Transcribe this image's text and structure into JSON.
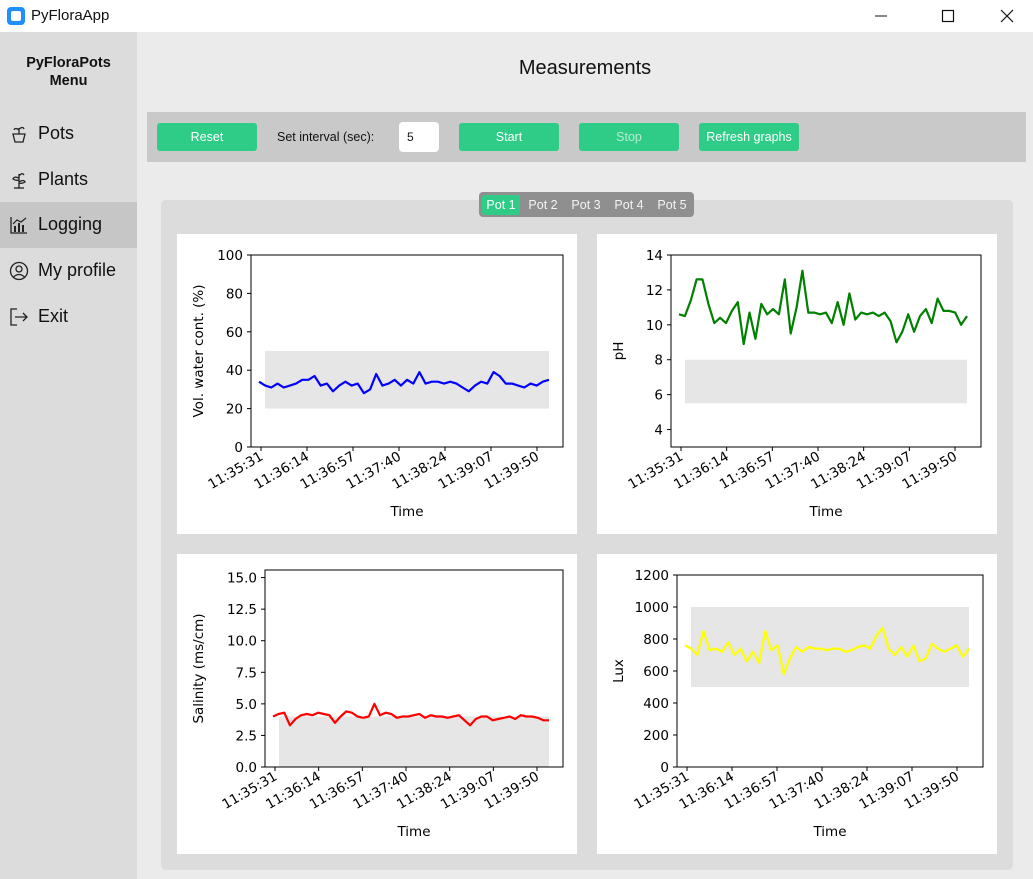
{
  "window": {
    "title": "PyFloraApp"
  },
  "sidebar": {
    "title_line1": "PyFloraPots",
    "title_line2": "Menu",
    "items": [
      {
        "label": "Pots",
        "icon": "pot-icon"
      },
      {
        "label": "Plants",
        "icon": "plant-icon"
      },
      {
        "label": "Logging",
        "icon": "chart-icon"
      },
      {
        "label": "My profile",
        "icon": "user-icon"
      },
      {
        "label": "Exit",
        "icon": "exit-icon"
      }
    ]
  },
  "page": {
    "title": "Measurements"
  },
  "toolbar": {
    "reset": "Reset",
    "interval_label": "Set interval (sec):",
    "interval_value": "5",
    "start": "Start",
    "stop": "Stop",
    "refresh": "Refresh graphs"
  },
  "tabs": [
    "Pot 1",
    "Pot 2",
    "Pot 3",
    "Pot 4",
    "Pot 5"
  ],
  "colors": {
    "accent": "#2ecc87",
    "band": "#e6e6e6"
  },
  "chart_data": [
    {
      "type": "line",
      "xlabel": "Time",
      "ylabel": "Vol. water cont. (%)",
      "ylim": [
        0,
        100
      ],
      "yticks": [
        "0",
        "20",
        "40",
        "60",
        "80",
        "100"
      ],
      "xticks": [
        "11:35:31",
        "11:36:14",
        "11:36:57",
        "11:37:40",
        "11:38:24",
        "11:39:07",
        "11:39:50"
      ],
      "band": [
        20,
        50
      ],
      "color": "#0000ff",
      "values": [
        34,
        32,
        31,
        33,
        31,
        32,
        33,
        35,
        35,
        37,
        32,
        33,
        29,
        32,
        34,
        32,
        33,
        28,
        30,
        38,
        32,
        33,
        35,
        32,
        35,
        33,
        39,
        33,
        34,
        34,
        33,
        34,
        33,
        31,
        29,
        32,
        34,
        33,
        39,
        37,
        33,
        33,
        32,
        31,
        33,
        32,
        34,
        35
      ]
    },
    {
      "type": "line",
      "xlabel": "Time",
      "ylabel": "pH",
      "ylim": [
        3,
        14
      ],
      "yticks": [
        "4",
        "6",
        "8",
        "10",
        "12",
        "14"
      ],
      "xticks": [
        "11:35:31",
        "11:36:14",
        "11:36:57",
        "11:37:40",
        "11:38:24",
        "11:39:07",
        "11:39:50"
      ],
      "band": [
        5.5,
        8
      ],
      "color": "#008000",
      "values": [
        10.6,
        10.5,
        11.4,
        12.6,
        12.6,
        11.2,
        10.1,
        10.4,
        10.1,
        10.8,
        11.3,
        8.9,
        10.7,
        9.2,
        11.2,
        10.6,
        10.9,
        10.6,
        12.6,
        9.5,
        11.0,
        13.1,
        10.7,
        10.7,
        10.6,
        10.7,
        10.1,
        11.3,
        10.0,
        11.8,
        10.3,
        10.7,
        10.6,
        10.7,
        10.5,
        10.7,
        10.2,
        9.0,
        9.6,
        10.6,
        9.6,
        10.5,
        10.9,
        10.1,
        11.5,
        10.8,
        10.8,
        10.7,
        10.0,
        10.5
      ]
    },
    {
      "type": "line",
      "xlabel": "Time",
      "ylabel": "Salinity (ms/cm)",
      "ylim": [
        0,
        15.6
      ],
      "yticks": [
        "0.0",
        "2.5",
        "5.0",
        "7.5",
        "10.0",
        "12.5",
        "15.0"
      ],
      "xticks": [
        "11:35:31",
        "11:36:14",
        "11:36:57",
        "11:37:40",
        "11:38:24",
        "11:39:07",
        "11:39:50"
      ],
      "band": [
        0,
        4
      ],
      "color": "#ff0000",
      "values": [
        4.0,
        4.2,
        4.3,
        3.3,
        3.8,
        4.1,
        4.2,
        4.1,
        4.3,
        4.2,
        4.1,
        3.5,
        4.0,
        4.4,
        4.3,
        4.0,
        3.9,
        4.0,
        5.0,
        4.1,
        4.3,
        4.2,
        3.9,
        4.0,
        4.0,
        4.1,
        4.2,
        3.9,
        4.1,
        4.0,
        4.0,
        3.9,
        4.0,
        4.1,
        3.7,
        3.3,
        3.8,
        4.0,
        4.0,
        3.7,
        3.8,
        3.9,
        4.0,
        3.8,
        4.1,
        4.0,
        4.0,
        3.9,
        3.7,
        3.7
      ]
    },
    {
      "type": "line",
      "xlabel": "Time",
      "ylabel": "Lux",
      "ylim": [
        0,
        1200
      ],
      "yticks": [
        "0",
        "200",
        "400",
        "600",
        "800",
        "1000",
        "1200"
      ],
      "xticks": [
        "11:35:31",
        "11:36:14",
        "11:36:57",
        "11:37:40",
        "11:38:24",
        "11:39:07",
        "11:39:50"
      ],
      "band": [
        500,
        1000
      ],
      "color": "#ffff00",
      "values": [
        760,
        740,
        700,
        850,
        730,
        740,
        720,
        780,
        700,
        740,
        660,
        720,
        650,
        850,
        730,
        760,
        580,
        680,
        750,
        720,
        750,
        740,
        740,
        730,
        740,
        740,
        720,
        730,
        750,
        760,
        740,
        820,
        870,
        740,
        700,
        750,
        690,
        760,
        660,
        680,
        770,
        740,
        720,
        740,
        760,
        690,
        740
      ]
    }
  ]
}
